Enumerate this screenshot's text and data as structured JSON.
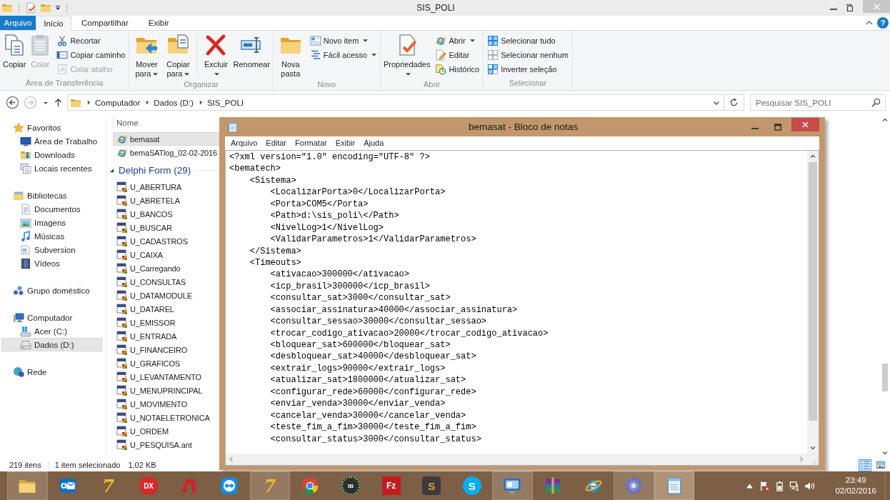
{
  "explorer": {
    "title": "SIS_POLI",
    "tabs": [
      {
        "label": "Arquivo",
        "kind": "menu",
        "selected": false
      },
      {
        "label": "Início",
        "kind": "tab",
        "selected": true
      },
      {
        "label": "Compartilhar",
        "kind": "tab",
        "selected": false
      },
      {
        "label": "Exibir",
        "kind": "tab",
        "selected": false
      }
    ],
    "help": "?",
    "ribbon": [
      {
        "label": "Área de Transferência",
        "sections": [
          {
            "kind": "large",
            "buttons": [
              {
                "label": "Copiar",
                "kind": "copy",
                "disabled": false,
                "dropdown": false
              },
              {
                "label": "Colar",
                "kind": "paste",
                "disabled": true,
                "dropdown": false
              }
            ]
          },
          {
            "kind": "small",
            "buttons": [
              {
                "label": "Recortar",
                "kind": "cut",
                "disabled": false,
                "dropdown": false
              },
              {
                "label": "Copiar caminho",
                "kind": "path",
                "disabled": false,
                "dropdown": false
              },
              {
                "label": "Colar atalho",
                "kind": "shortcut",
                "disabled": true,
                "dropdown": false
              }
            ]
          }
        ]
      },
      {
        "label": "Organizar",
        "sections": [
          {
            "kind": "large",
            "buttons": [
              {
                "label": "Mover para",
                "kind": "move",
                "disabled": false,
                "dropdown": true
              },
              {
                "label": "Copiar para",
                "kind": "copyto",
                "disabled": false,
                "dropdown": true
              }
            ]
          },
          {
            "kind": "large",
            "buttons": [
              {
                "label": "Excluir",
                "kind": "delete",
                "disabled": false,
                "dropdown": true
              },
              {
                "label": "Renomear",
                "kind": "rename",
                "disabled": false,
                "dropdown": false
              }
            ]
          }
        ]
      },
      {
        "label": "Novo",
        "sections": [
          {
            "kind": "large",
            "buttons": [
              {
                "label": "Nova pasta",
                "kind": "newfolder",
                "disabled": false,
                "dropdown": false
              }
            ]
          },
          {
            "kind": "small",
            "buttons": [
              {
                "label": "Novo item",
                "kind": "newitem",
                "disabled": false,
                "dropdown": true
              },
              {
                "label": "Fácil acesso",
                "kind": "easy",
                "disabled": false,
                "dropdown": true
              }
            ]
          }
        ]
      },
      {
        "label": "Abrir",
        "sections": [
          {
            "kind": "large",
            "buttons": [
              {
                "label": "Propriedades",
                "kind": "properties",
                "disabled": false,
                "dropdown": true
              }
            ]
          },
          {
            "kind": "small",
            "buttons": [
              {
                "label": "Abrir",
                "kind": "open",
                "disabled": false,
                "dropdown": true
              },
              {
                "label": "Editar",
                "kind": "edit",
                "disabled": false,
                "dropdown": false
              },
              {
                "label": "Histórico",
                "kind": "history",
                "disabled": false,
                "dropdown": false
              }
            ]
          }
        ]
      },
      {
        "label": "Selecionar",
        "sections": [
          {
            "kind": "small",
            "buttons": [
              {
                "label": "Selecionar tudo",
                "kind": "all",
                "disabled": false,
                "dropdown": false
              },
              {
                "label": "Selecionar nenhum",
                "kind": "none",
                "disabled": false,
                "dropdown": false
              },
              {
                "label": "Inverter seleção",
                "kind": "invert",
                "disabled": false,
                "dropdown": false
              }
            ]
          }
        ]
      }
    ],
    "address": {
      "path": [
        "Computador",
        "Dados (D:)",
        "SIS_POLI"
      ]
    },
    "search": {
      "placeholder": "Pesquisar SIS_POLI"
    },
    "navigation": [
      {
        "label": "Favoritos",
        "kind": "star",
        "selected": false,
        "children": [
          {
            "label": "Área de Trabalho",
            "kind": "desktop",
            "selected": false
          },
          {
            "label": "Downloads",
            "kind": "downloads",
            "selected": false
          },
          {
            "label": "Locais recentes",
            "kind": "recent",
            "selected": false
          }
        ]
      },
      {
        "label": "Bibliotecas",
        "kind": "library",
        "selected": false,
        "children": [
          {
            "label": "Documentos",
            "kind": "documents",
            "selected": false
          },
          {
            "label": "Imagens",
            "kind": "pictures",
            "selected": false
          },
          {
            "label": "Músicas",
            "kind": "music",
            "selected": false
          },
          {
            "label": "Subversion",
            "kind": "subversion",
            "selected": false
          },
          {
            "label": "Vídeos",
            "kind": "videos",
            "selected": false
          }
        ]
      },
      {
        "label": "Grupo doméstico",
        "kind": "homegroup",
        "selected": false
      },
      {
        "label": "Computador",
        "kind": "computer",
        "selected": false,
        "children": [
          {
            "label": "Acer (C:)",
            "kind": "system",
            "selected": false
          },
          {
            "label": "Dados (D:)",
            "kind": "drive",
            "selected": true
          }
        ]
      },
      {
        "label": "Rede",
        "kind": "network",
        "selected": false
      }
    ],
    "file_list": {
      "column": "Nome",
      "files": [
        {
          "name": "bemasat",
          "kind": "web",
          "selected": true
        },
        {
          "name": "bemaSATlog_02-02-2016",
          "kind": "web",
          "selected": false
        }
      ],
      "groups": [
        {
          "label": "Delphi Form (29)",
          "expanded": true,
          "files": [
            {
              "name": "U_ABERTURA",
              "kind": "form",
              "selected": false
            },
            {
              "name": "U_ABRETELA",
              "kind": "form",
              "selected": false
            },
            {
              "name": "U_BANCOS",
              "kind": "form",
              "selected": false
            },
            {
              "name": "U_BUSCAR",
              "kind": "form",
              "selected": false
            },
            {
              "name": "U_CADASTROS",
              "kind": "form",
              "selected": false
            },
            {
              "name": "U_CAIXA",
              "kind": "form",
              "selected": false
            },
            {
              "name": "U_Carregando",
              "kind": "form",
              "selected": false
            },
            {
              "name": "U_CONSULTAS",
              "kind": "form",
              "selected": false
            },
            {
              "name": "U_DATAMODULE",
              "kind": "form",
              "selected": false
            },
            {
              "name": "U_DATAREL",
              "kind": "form",
              "selected": false
            },
            {
              "name": "U_EMISSOR",
              "kind": "form",
              "selected": false
            },
            {
              "name": "U_ENTRADA",
              "kind": "form",
              "selected": false
            },
            {
              "name": "U_FINANCEIRO",
              "kind": "form",
              "selected": false
            },
            {
              "name": "U_GRAFICOS",
              "kind": "form",
              "selected": false
            },
            {
              "name": "U_LEVANTAMENTO",
              "kind": "form",
              "selected": false
            },
            {
              "name": "U_MENUPRINCIPAL",
              "kind": "form",
              "selected": false
            },
            {
              "name": "U_MOVIMENTO",
              "kind": "form",
              "selected": false
            },
            {
              "name": "U_NOTAELETRONICA",
              "kind": "form",
              "selected": false
            },
            {
              "name": "U_ORDEM",
              "kind": "form",
              "selected": false
            },
            {
              "name": "U_PESQUISA.ant",
              "kind": "form",
              "selected": false
            }
          ]
        }
      ]
    },
    "status_bar": {
      "count": "219 itens",
      "selection": "1 item selecionado",
      "size": "1,02 KB"
    },
    "views": [
      {
        "kind": "details",
        "selected": true
      },
      {
        "kind": "tiles",
        "selected": false
      }
    ]
  },
  "notepad": {
    "title": "bemasat - Bloco de notas",
    "menu": [
      "Arquivo",
      "Editar",
      "Formatar",
      "Exibir",
      "Ajuda"
    ],
    "lines": [
      {
        "text": "<?xml version=\"1.0\" encoding=\"UTF-8\" ?>"
      },
      {
        "text": "<bematech>",
        "children": [
          {
            "text": "<Sistema>",
            "children": [
              {
                "text": "<LocalizarPorta>0</LocalizarPorta>"
              },
              {
                "text": "<Porta>COM5</Porta>"
              },
              {
                "text": "<Path>d:\\sis_poli\\</Path>"
              },
              {
                "text": "<NivelLog>1</NivelLog>"
              },
              {
                "text": "<ValidarParametros>1</ValidarParametros>"
              }
            ]
          },
          {
            "text": "</Sistema>"
          },
          {
            "text": "<Timeouts>",
            "children": [
              {
                "text": "<ativacao>300000</ativacao>"
              },
              {
                "text": "<icp_brasil>300000</icp_brasil>"
              },
              {
                "text": "<consultar_sat>3000</consultar_sat>"
              },
              {
                "text": "<associar_assinatura>40000</associar_assinatura>"
              },
              {
                "text": "<consultar_sessao>30000</consultar_sessao>"
              },
              {
                "text": "<trocar_codigo_ativacao>20000</trocar_codigo_ativacao>"
              },
              {
                "text": "<bloquear_sat>600000</bloquear_sat>"
              },
              {
                "text": "<desbloquear_sat>40000</desbloquear_sat>"
              },
              {
                "text": "<extrair_logs>90000</extrair_logs>"
              },
              {
                "text": "<atualizar_sat>1800000</atualizar_sat>"
              },
              {
                "text": "<configurar_rede>60000</configurar_rede>"
              },
              {
                "text": "<enviar_venda>30000</enviar_venda>"
              },
              {
                "text": "<cancelar_venda>30000</cancelar_venda>"
              },
              {
                "text": "<teste_fim_a_fim>30000</teste_fim_a_fim>"
              },
              {
                "text": "<consultar_status>3000</consultar_status>"
              }
            ]
          }
        ]
      }
    ]
  },
  "taskbar": {
    "items": [
      {
        "kind": "folder",
        "running": true,
        "selected": false
      },
      {
        "kind": "mail",
        "running": false,
        "selected": false
      },
      {
        "kind": "numeral",
        "glyph": "7",
        "running": false,
        "selected": false
      },
      {
        "kind": "badge",
        "glyph": "DX",
        "running": false,
        "selected": false
      },
      {
        "kind": "arch",
        "running": false,
        "selected": false
      },
      {
        "kind": "arrows",
        "running": false,
        "selected": false
      },
      {
        "kind": "numeral",
        "glyph": "7",
        "running": true,
        "selected": false
      },
      {
        "kind": "wheel",
        "running": false,
        "selected": false
      },
      {
        "kind": "dots",
        "glyph": "IB",
        "running": false,
        "selected": false
      },
      {
        "kind": "tile",
        "glyph": "Fz",
        "running": false,
        "selected": false
      },
      {
        "kind": "slate",
        "glyph": "S",
        "running": false,
        "selected": false
      },
      {
        "kind": "bubble",
        "glyph": "S",
        "running": false,
        "selected": false
      },
      {
        "kind": "monitor",
        "running": true,
        "selected": false
      },
      {
        "kind": "books",
        "running": false,
        "selected": false
      },
      {
        "kind": "orbit",
        "running": false,
        "selected": false
      },
      {
        "kind": "gear",
        "running": true,
        "selected": false
      },
      {
        "kind": "notepad",
        "running": true,
        "selected": true
      }
    ],
    "time": "23:49",
    "date": "02/02/2016"
  }
}
